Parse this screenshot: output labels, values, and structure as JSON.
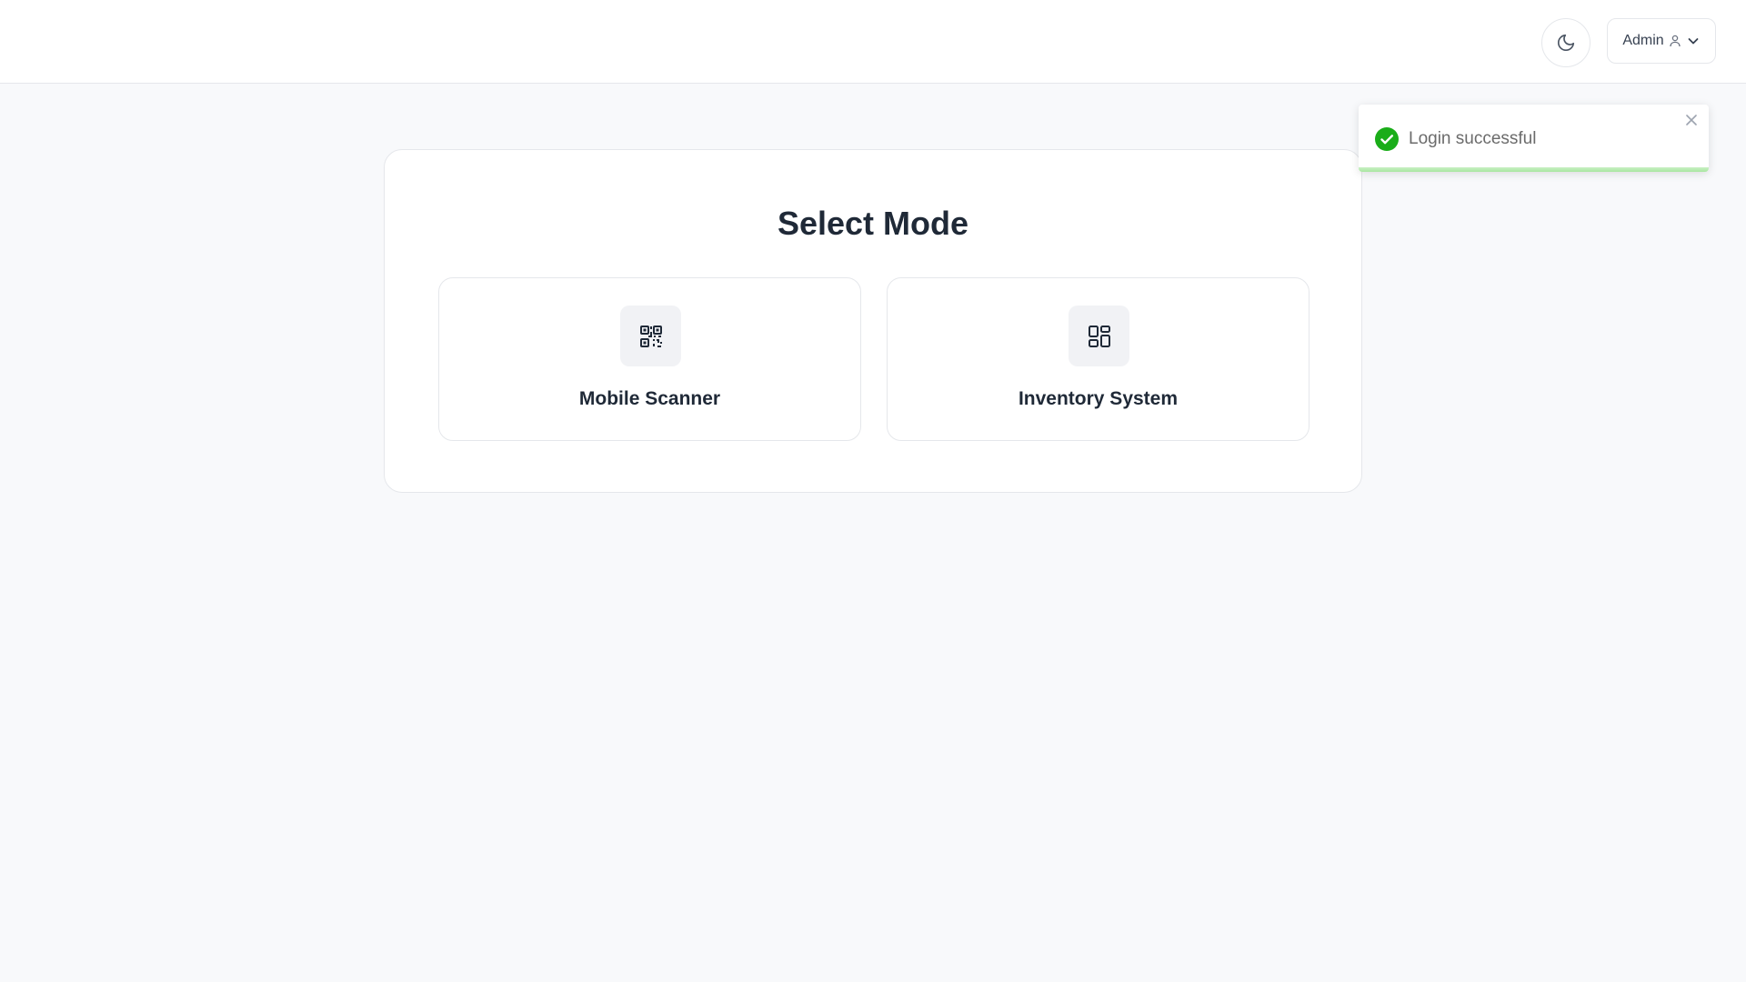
{
  "header": {
    "theme_toggle_icon": "moon-icon",
    "user": {
      "name": "Admin",
      "user_icon": "user-icon",
      "dropdown_icon": "chevron-down-icon"
    }
  },
  "main": {
    "title": "Select Mode",
    "options": [
      {
        "label": "Mobile Scanner",
        "icon": "qr-code-icon"
      },
      {
        "label": "Inventory System",
        "icon": "dashboard-grid-icon"
      }
    ]
  },
  "toast": {
    "message": "Login successful",
    "status_icon": "check-circle-icon",
    "close_icon": "close-icon",
    "status_color": "#22c55e"
  }
}
